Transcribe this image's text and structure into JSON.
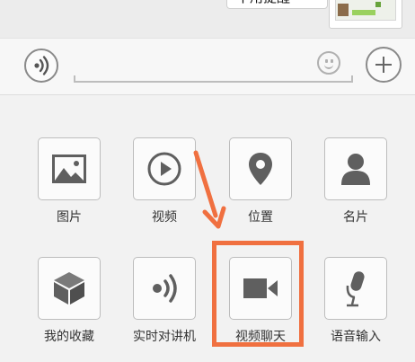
{
  "chat": {
    "bubble_text": "?? 通知提醒 ??"
  },
  "input_bar": {
    "voice_icon": "voice-icon",
    "emoji_icon": "emoji-icon",
    "plus_icon": "plus-icon"
  },
  "panel": {
    "items": [
      {
        "label": "图片",
        "icon": "image-icon"
      },
      {
        "label": "视频",
        "icon": "play-icon"
      },
      {
        "label": "位置",
        "icon": "location-pin-icon"
      },
      {
        "label": "名片",
        "icon": "person-icon"
      },
      {
        "label": "我的收藏",
        "icon": "cube-icon"
      },
      {
        "label": "实时对讲机",
        "icon": "walkie-talkie-icon"
      },
      {
        "label": "视频聊天",
        "icon": "video-camera-icon"
      },
      {
        "label": "语音输入",
        "icon": "microphone-icon"
      }
    ]
  },
  "annotation": {
    "color": "#f07040"
  }
}
